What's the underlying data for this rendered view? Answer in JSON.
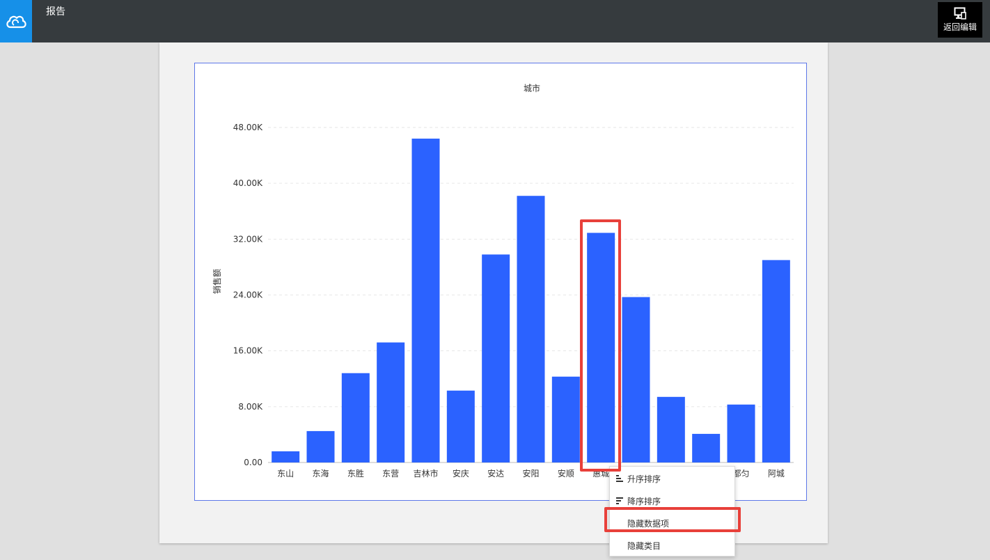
{
  "header": {
    "title": "报告",
    "back_label": "返回编辑",
    "logo_icon": "cloud-logo-icon",
    "back_icon": "device-edit-icon"
  },
  "colors": {
    "bar": "#2b62ff",
    "header_bg": "#363b3e",
    "logo_bg": "#1690e8",
    "highlight": "#e8403a"
  },
  "chart_data": {
    "type": "bar",
    "title": "城市",
    "ylabel": "销售额",
    "xlabel": "",
    "categories": [
      "东山",
      "东海",
      "东胜",
      "东营",
      "吉林市",
      "安庆",
      "安达",
      "安阳",
      "安顺",
      "惠城",
      "",
      "",
      "",
      "都匀",
      "阿城"
    ],
    "values": [
      1600,
      4500,
      12800,
      17200,
      46400,
      10300,
      29800,
      38200,
      12300,
      32900,
      23700,
      9400,
      4100,
      8300,
      29000
    ],
    "ylim": [
      0,
      48000
    ],
    "yticks": [
      "0.00",
      "8.00K",
      "16.00K",
      "24.00K",
      "32.00K",
      "40.00K",
      "48.00K"
    ],
    "grid": true
  },
  "context_menu": {
    "items": [
      {
        "label": "升序排序",
        "icon": "sort-ascending-icon"
      },
      {
        "label": "降序排序",
        "icon": "sort-descending-icon"
      },
      {
        "label": "隐藏数据项",
        "icon": ""
      },
      {
        "label": "隐藏类目",
        "icon": ""
      }
    ]
  }
}
